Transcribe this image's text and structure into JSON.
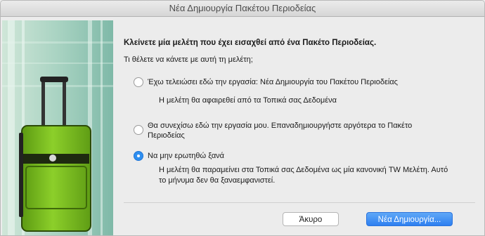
{
  "window": {
    "title": "Νέα Δημιουργία Πακέτου Περιοδείας"
  },
  "main": {
    "heading": "Κλείνετε μία μελέτη που έχει εισαχθεί από ένα Πακέτο Περιοδείας.",
    "question": "Τι θέλετε να κάνετε με αυτή τη μελέτη;",
    "options": [
      {
        "label": "Έχω τελειώσει εδώ την εργασία: Νέα Δημιουργία του Πακέτου Περιοδείας",
        "description": "Η μελέτη θα αφαιρεθεί από τα Τοπικά σας Δεδομένα",
        "selected": false
      },
      {
        "label_line1": "Θα συνεχίσω εδώ την εργασία μου. Επαναδημιουργήστε αργότερα το Πακέτο",
        "label_line2": "Περιοδείας",
        "selected": false
      },
      {
        "label": "Να μην ερωτηθώ ξανά",
        "description_line1": "Η μελέτη θα παραμείνει στα Τοπικά σας Δεδομένα ως μία κανονική TW Μελέτη. Αυτό",
        "description_line2": "το μήνυμα δεν θα ξαναεμφανιστεί.",
        "selected": true
      }
    ]
  },
  "buttons": {
    "cancel_label": "Άκυρο",
    "confirm_label": "Νέα Δημιουργία..."
  },
  "colors": {
    "accent": "#2f8ff0",
    "side_bg": "#8dc3b2",
    "suitcase": "#7cbf1f"
  }
}
